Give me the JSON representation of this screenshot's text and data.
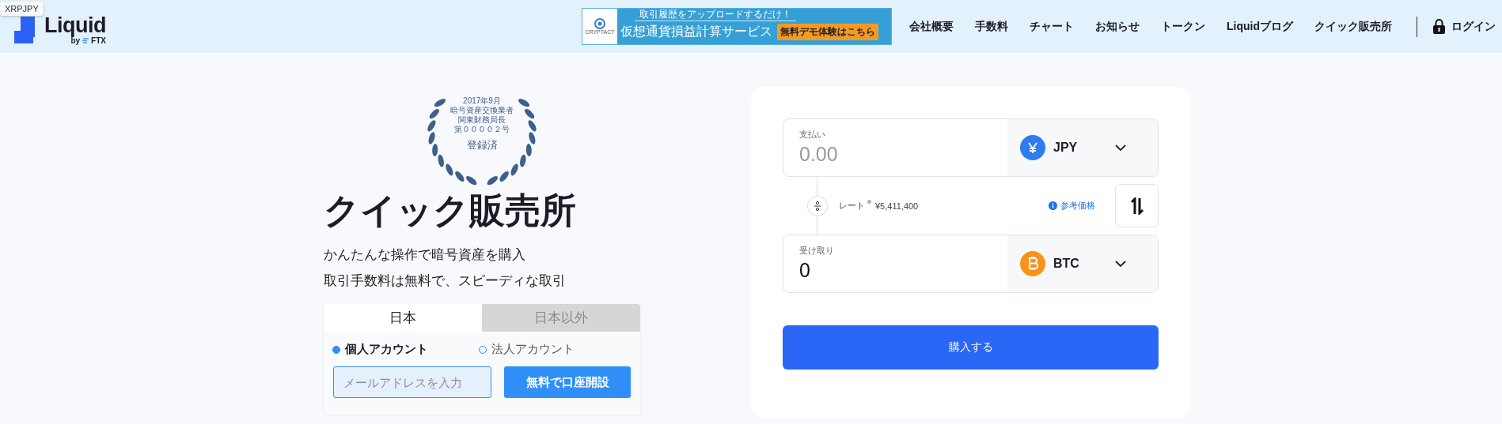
{
  "ticker_tooltip": "XRPJPY",
  "logo": {
    "name": "Liquid",
    "byline": "by",
    "partner": "FTX"
  },
  "ad_banner": {
    "brand": "CRYPTACT",
    "tagline": "取引履歴をアップロードするだけ！",
    "headline": "仮想通貨損益計算サービス",
    "cta": "無料デモ体験はこちら"
  },
  "nav": [
    {
      "label": "会社概要"
    },
    {
      "label": "手数料"
    },
    {
      "label": "チャート"
    },
    {
      "label": "お知らせ"
    },
    {
      "label": "トークン"
    },
    {
      "label": "Liquidブログ"
    },
    {
      "label": "クイック販売所"
    }
  ],
  "login": "ログイン",
  "badge": {
    "lines": [
      "2017年9月",
      "暗号資産交換業者",
      "関東財務局長",
      "第００００２号"
    ],
    "status": "登録済"
  },
  "title": "クイック販売所",
  "subtitles": [
    "かんたんな操作で暗号資産を購入",
    "取引手数料は無料で、スピーディな取引"
  ],
  "region_tabs": [
    {
      "label": "日本",
      "selected": true
    },
    {
      "label": "日本以外",
      "selected": false
    }
  ],
  "account_types": [
    {
      "label": "個人アカウント",
      "selected": true
    },
    {
      "label": "法人アカウント",
      "selected": false
    }
  ],
  "email_field": {
    "placeholder": "メールアドレスを入力"
  },
  "signup_button": "無料で口座開設",
  "exchange": {
    "pay": {
      "label": "支払い",
      "placeholder": "0.00",
      "currency": "JPY",
      "kind": "yen"
    },
    "rate": {
      "label": "レート",
      "value": "¥5,411,400"
    },
    "reference_link": "参考価格",
    "receive": {
      "label": "受け取り",
      "value": "0",
      "currency": "BTC",
      "kind": "bitcoin"
    },
    "buy_button": "購入する"
  }
}
